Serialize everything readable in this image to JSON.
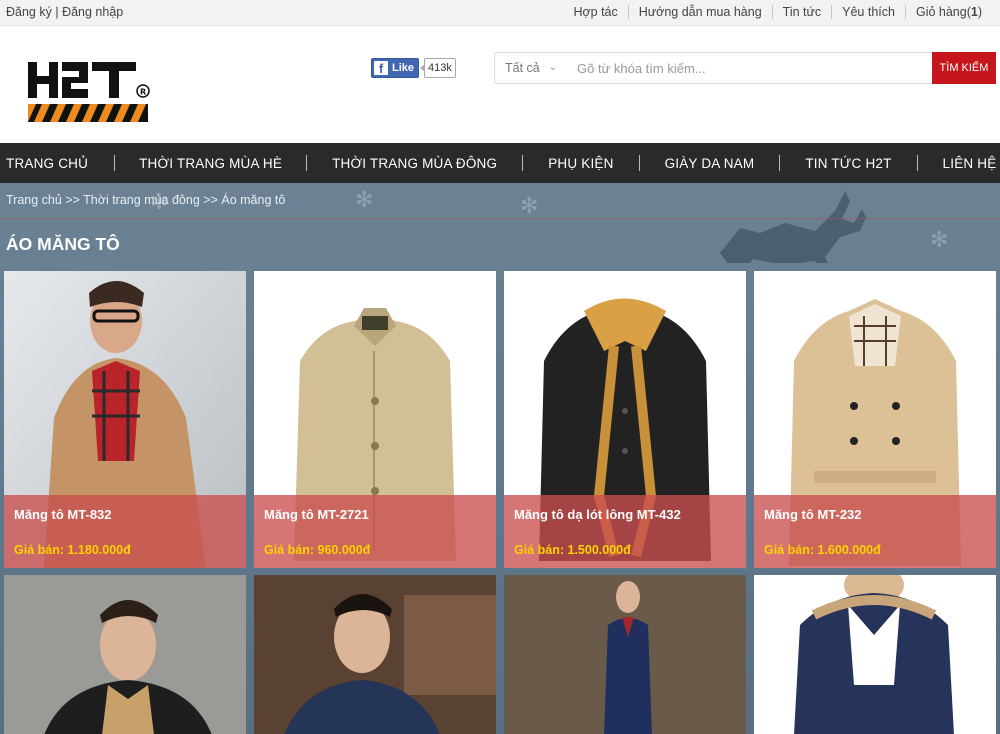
{
  "topbar": {
    "register": "Đăng ký",
    "separator": "|",
    "login": "Đăng nhập",
    "links": [
      "Hợp tác",
      "Hướng dẫn mua hàng",
      "Tin tức",
      "Yêu thích"
    ],
    "cart_label": "Giỏ hàng(",
    "cart_count": "1",
    "cart_close": ")"
  },
  "header": {
    "fb_like": "Like",
    "fb_count": "413k",
    "search_category": "Tất cả",
    "search_placeholder": "Gõ từ khóa tìm kiếm...",
    "search_button": "TÌM KIẾM"
  },
  "nav": {
    "items": [
      "Trang chủ",
      "Thời trang mùa hè",
      "Thời trang mùa đông",
      "Phụ kiện",
      "Giày da nam",
      "Tin tức H2T",
      "Liên hệ"
    ]
  },
  "breadcrumb": {
    "items": [
      "Trang chủ",
      "Thời trang mùa đông",
      "Áo măng tô"
    ],
    "separator": ">>"
  },
  "page_title": "Áo măng tô",
  "products": [
    {
      "name": "Măng tô MT-832",
      "price_label": "Giá bán:",
      "price": "1.180.000đ"
    },
    {
      "name": "Măng tô MT-2721",
      "price_label": "Giá bán:",
      "price": "960.000đ"
    },
    {
      "name": "Măng tô dạ lót lông MT-432",
      "price_label": "Giá bán:",
      "price": "1.500.000đ"
    },
    {
      "name": "Măng tô MT-232",
      "price_label": "Giá bán:",
      "price": "1.600.000đ"
    }
  ],
  "colors": {
    "nav_bg": "#2a2a2a",
    "accent_red": "#c4161c",
    "overlay_red": "#c94e4e",
    "price_yellow": "#ffd200"
  }
}
